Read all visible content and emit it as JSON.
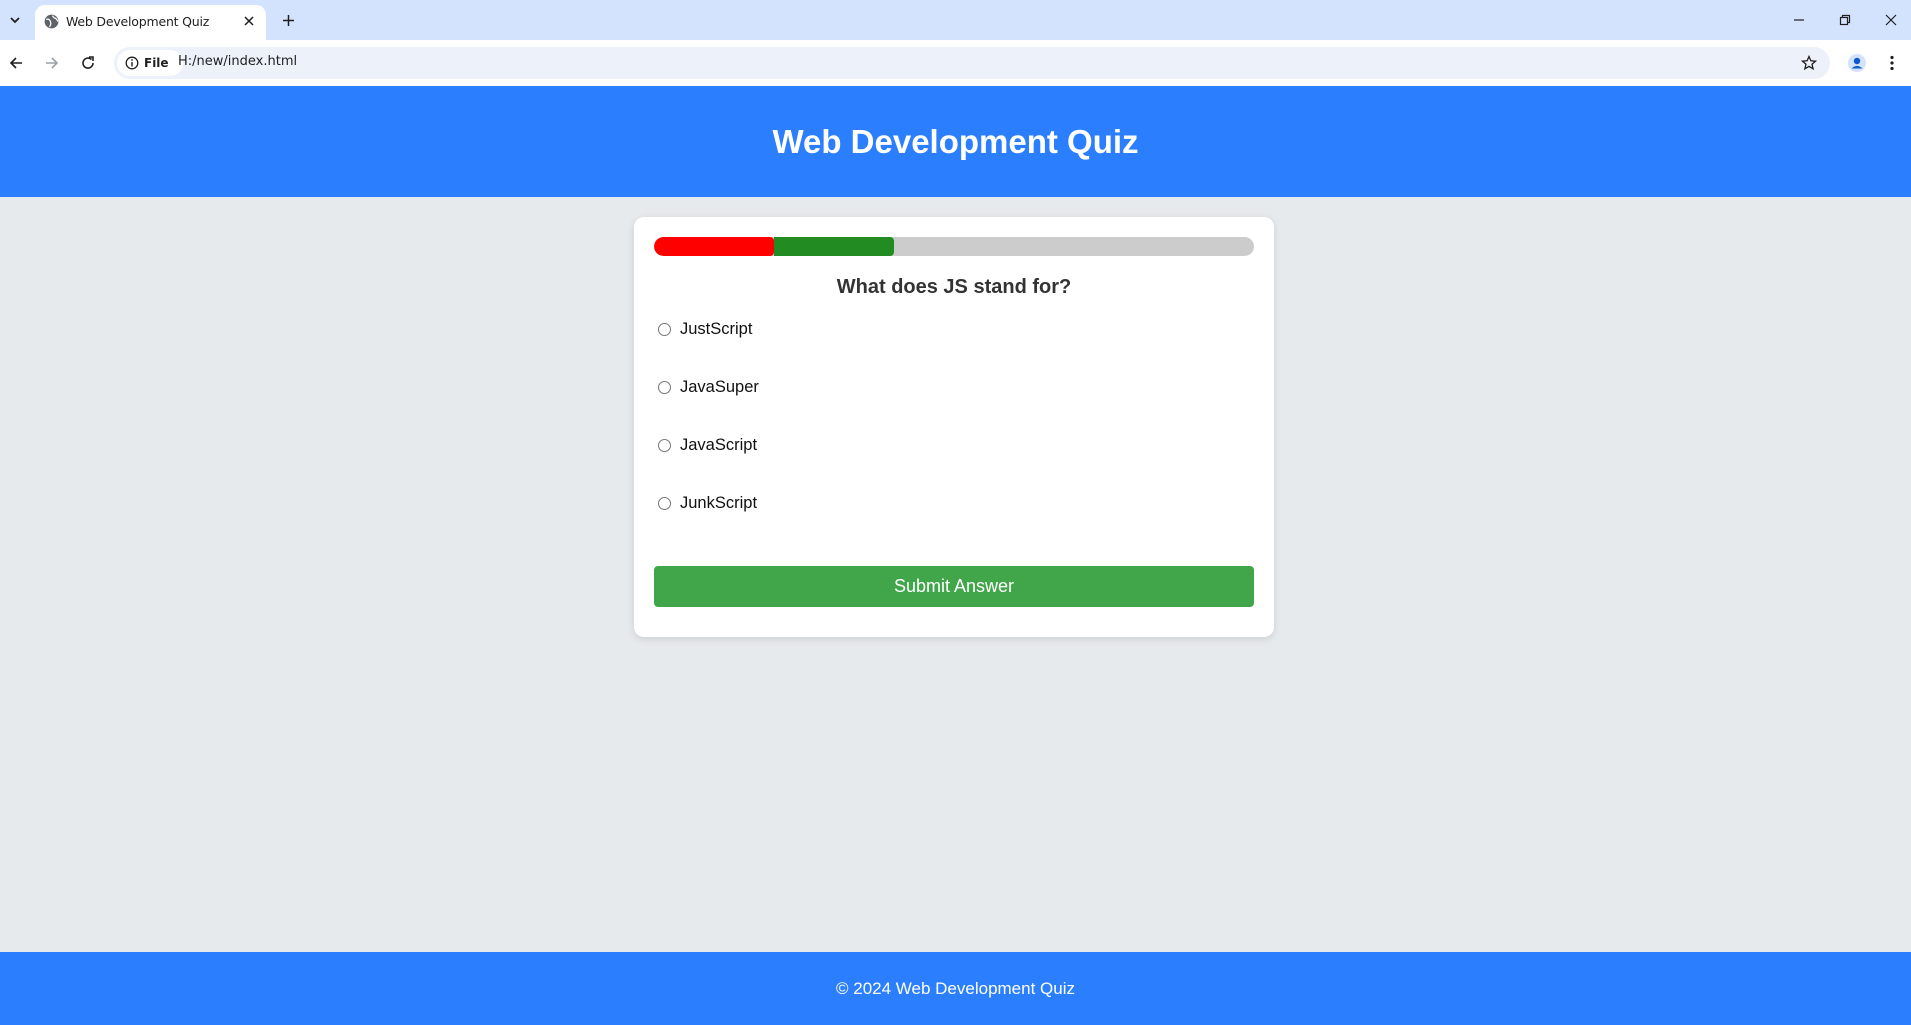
{
  "browser": {
    "tab_title": "Web Development Quiz",
    "site_chip": "File",
    "url": "H:/new/index.html"
  },
  "header": {
    "title": "Web Development Quiz"
  },
  "quiz": {
    "progress": {
      "incorrect_fraction": 0.2,
      "correct_fraction": 0.2,
      "colors": {
        "incorrect": "#ff0000",
        "correct": "#228b22",
        "remaining": "#cccccc"
      }
    },
    "question": "What does JS stand for?",
    "options": [
      "JustScript",
      "JavaSuper",
      "JavaScript",
      "JunkScript"
    ],
    "submit_label": "Submit Answer"
  },
  "footer": {
    "text": "© 2024 Web Development Quiz"
  },
  "colors": {
    "brand": "#2b7fff",
    "submit": "#41a54a",
    "background": "#e7eaed"
  }
}
